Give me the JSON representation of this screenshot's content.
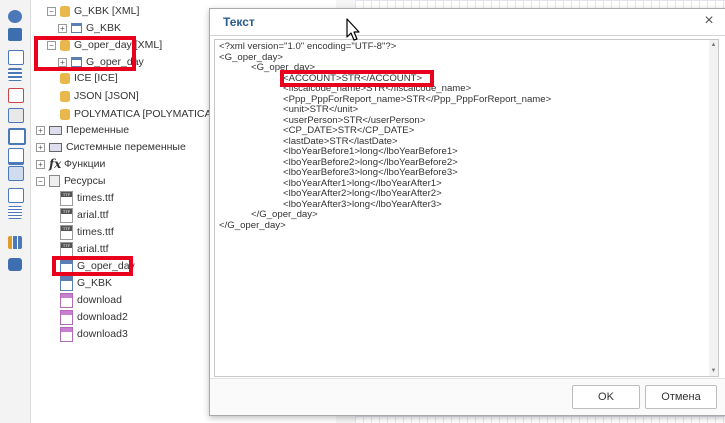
{
  "tree": {
    "items": [
      {
        "label": "G_KBK [XML]",
        "icon": "database-icon",
        "expander": "−"
      },
      {
        "label": "G_KBK",
        "icon": "table-icon",
        "expander": "+"
      },
      {
        "label": "G_oper_day [XML]",
        "icon": "database-icon",
        "expander": "−"
      },
      {
        "label": "G_oper_day",
        "icon": "table-icon",
        "expander": "+"
      },
      {
        "label": "ICE [ICE]",
        "icon": "database-icon"
      },
      {
        "label": "JSON [JSON]",
        "icon": "database-icon"
      },
      {
        "label": "POLYMATICA [POLYMATICA]",
        "icon": "database-icon"
      },
      {
        "label": "Переменные",
        "icon": "variables-icon",
        "expander": "+"
      },
      {
        "label": "Системные переменные",
        "icon": "system-variables-icon",
        "expander": "+"
      },
      {
        "label": "Функции",
        "icon": "function-icon",
        "expander": "+"
      },
      {
        "label": "Ресурсы",
        "icon": "resources-icon",
        "expander": "−"
      },
      {
        "label": "times.ttf",
        "icon": "ttf-file-icon"
      },
      {
        "label": "arial.ttf",
        "icon": "ttf-file-icon"
      },
      {
        "label": "times.ttf",
        "icon": "ttf-file-icon"
      },
      {
        "label": "arial.ttf",
        "icon": "ttf-file-icon"
      },
      {
        "label": "G_oper_day",
        "icon": "xml-file-icon"
      },
      {
        "label": "G_KBK",
        "icon": "xml-file-icon"
      },
      {
        "label": "download",
        "icon": "image-file-icon"
      },
      {
        "label": "download2",
        "icon": "image-file-icon"
      },
      {
        "label": "download3",
        "icon": "image-file-icon"
      }
    ]
  },
  "dialog": {
    "title": "Текст",
    "close_symbol": "×",
    "text_lines": [
      "<?xml version=\"1.0\" encoding=\"UTF-8\"?>",
      "<G_oper_day>",
      "            <G_oper_day>",
      "                        <ACCOUNT>STR</ACCOUNT>",
      "                        <fiscalcode_name>STR</fiscalcode_name>",
      "                        <Ppp_PppForReport_name>STR</Ppp_PppForReport_name>",
      "                        <unit>STR</unit>",
      "                        <userPerson>STR</userPerson>",
      "                        <CP_DATE>STR</CP_DATE>",
      "                        <lastDate>STR</lastDate>",
      "                        <lboYearBefore1>long</lboYearBefore1>",
      "                        <lboYearBefore2>long</lboYearBefore2>",
      "                        <lboYearBefore3>long</lboYearBefore3>",
      "                        <lboYearAfter1>long</lboYearAfter1>",
      "                        <lboYearAfter2>long</lboYearAfter2>",
      "                        <lboYearAfter3>long</lboYearAfter3>",
      "            </G_oper_day>",
      "</G_oper_day>"
    ],
    "ok_label": "OK",
    "cancel_label": "Отмена"
  },
  "colors": {
    "highlight": "#e8001c",
    "title_blue": "#2a5d8f"
  }
}
